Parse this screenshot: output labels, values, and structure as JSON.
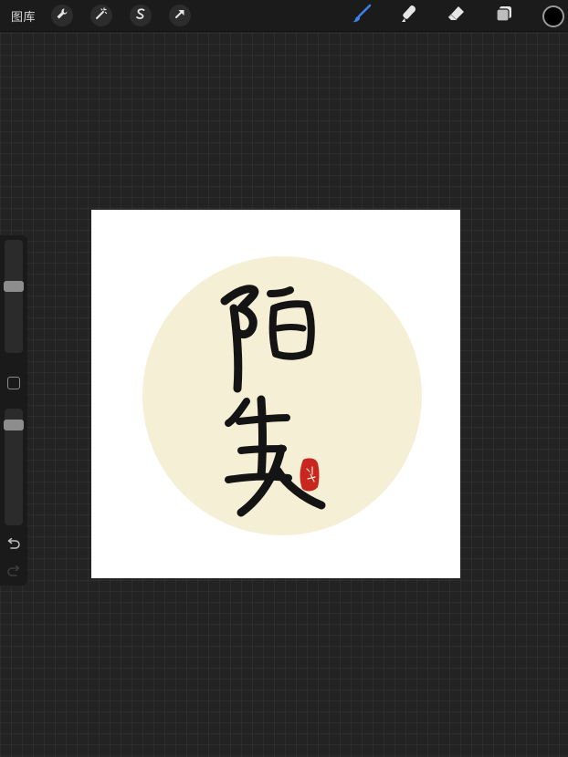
{
  "topbar": {
    "gallery_label": "图库",
    "left_tools": [
      "wrench-icon",
      "magic-wand-icon",
      "selection-icon",
      "transform-arrow-icon"
    ],
    "right_tools": [
      "brush-icon",
      "smudge-icon",
      "eraser-icon",
      "layers-icon"
    ],
    "active_tool": "brush-icon",
    "accent_color": "#3b82e6",
    "current_color": "#000000"
  },
  "sidebar": {
    "size_slider_level": 0.4,
    "opacity_slider_level": 0.1
  },
  "artwork": {
    "background_color": "#ffffff",
    "circle_color": "#f5efd5",
    "calligraphy_text": "陌生人",
    "seal_text": "小城",
    "seal_color": "#c9261f"
  }
}
